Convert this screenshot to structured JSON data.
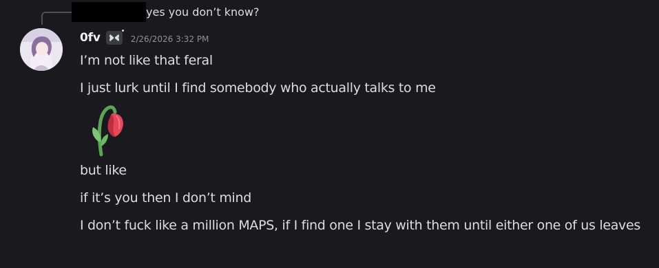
{
  "reply": {
    "author_redacted": true,
    "text": "yes you don’t know?"
  },
  "message": {
    "username": "0fv",
    "tag_icon": "butterfly-icon",
    "timestamp": "2/26/2026 3:32 PM",
    "lines": [
      "I’m not like that feral",
      "I just lurk until I find somebody who actually talks to me",
      "but like",
      "if it’s you then I don’t mind",
      "I don’t fuck like a million MAPS, if I find one I stay with them until either one of us leaves"
    ],
    "emoji": "wilted-flower-emoji"
  },
  "colors": {
    "background": "#1a1a1e",
    "text": "#dbdee1",
    "username": "#f2f3f5",
    "timestamp": "#8e9297",
    "reply_spine": "#4e5058"
  }
}
